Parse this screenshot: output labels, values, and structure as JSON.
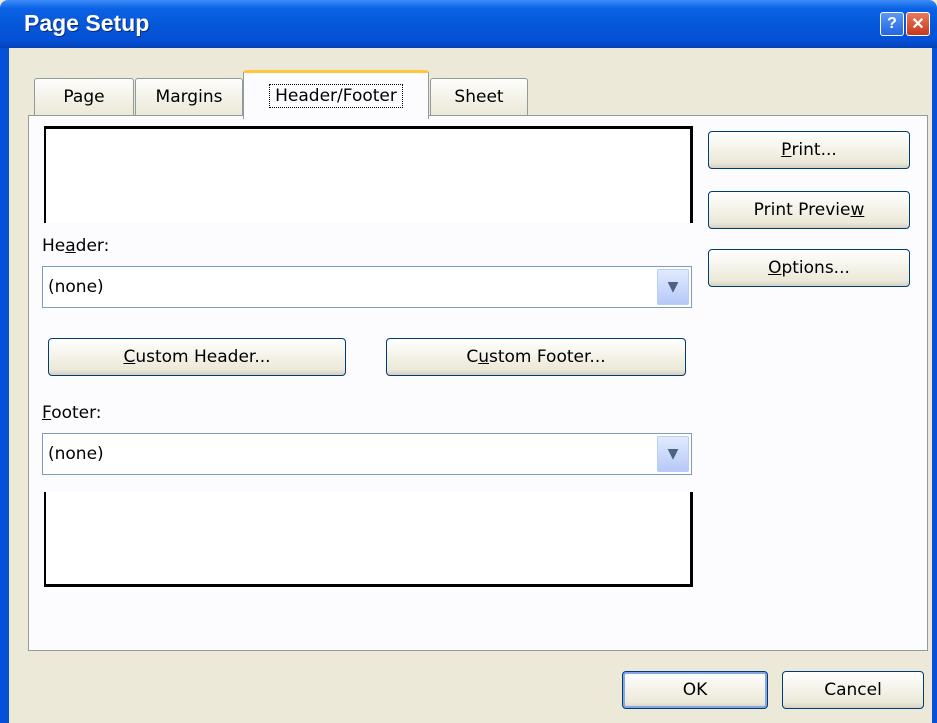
{
  "window": {
    "title": "Page Setup",
    "help_glyph": "?",
    "close_glyph": "✕"
  },
  "tabs": [
    {
      "label": "Page"
    },
    {
      "label": "Margins"
    },
    {
      "label": "Header/Footer"
    },
    {
      "label": "Sheet"
    }
  ],
  "header": {
    "label_pre": "He",
    "label_key": "a",
    "label_post": "der:",
    "value": "(none)"
  },
  "footer": {
    "label_key": "F",
    "label_post": "ooter:",
    "value": "(none)"
  },
  "custom_header": {
    "key": "C",
    "rest": "ustom Header..."
  },
  "custom_footer": {
    "pre": "C",
    "key": "u",
    "rest": "stom Footer..."
  },
  "side_buttons": {
    "print": {
      "key": "P",
      "rest": "rint..."
    },
    "print_preview": {
      "pre": "Print Previe",
      "key": "w"
    },
    "options": {
      "key": "O",
      "rest": "ptions..."
    }
  },
  "bottom": {
    "ok_label": "OK",
    "cancel_label": "Cancel"
  },
  "colors": {
    "titlebar": "#0550d6",
    "dialog_bg": "#ece9d8",
    "active_tab_accent": "#ffc83c"
  }
}
